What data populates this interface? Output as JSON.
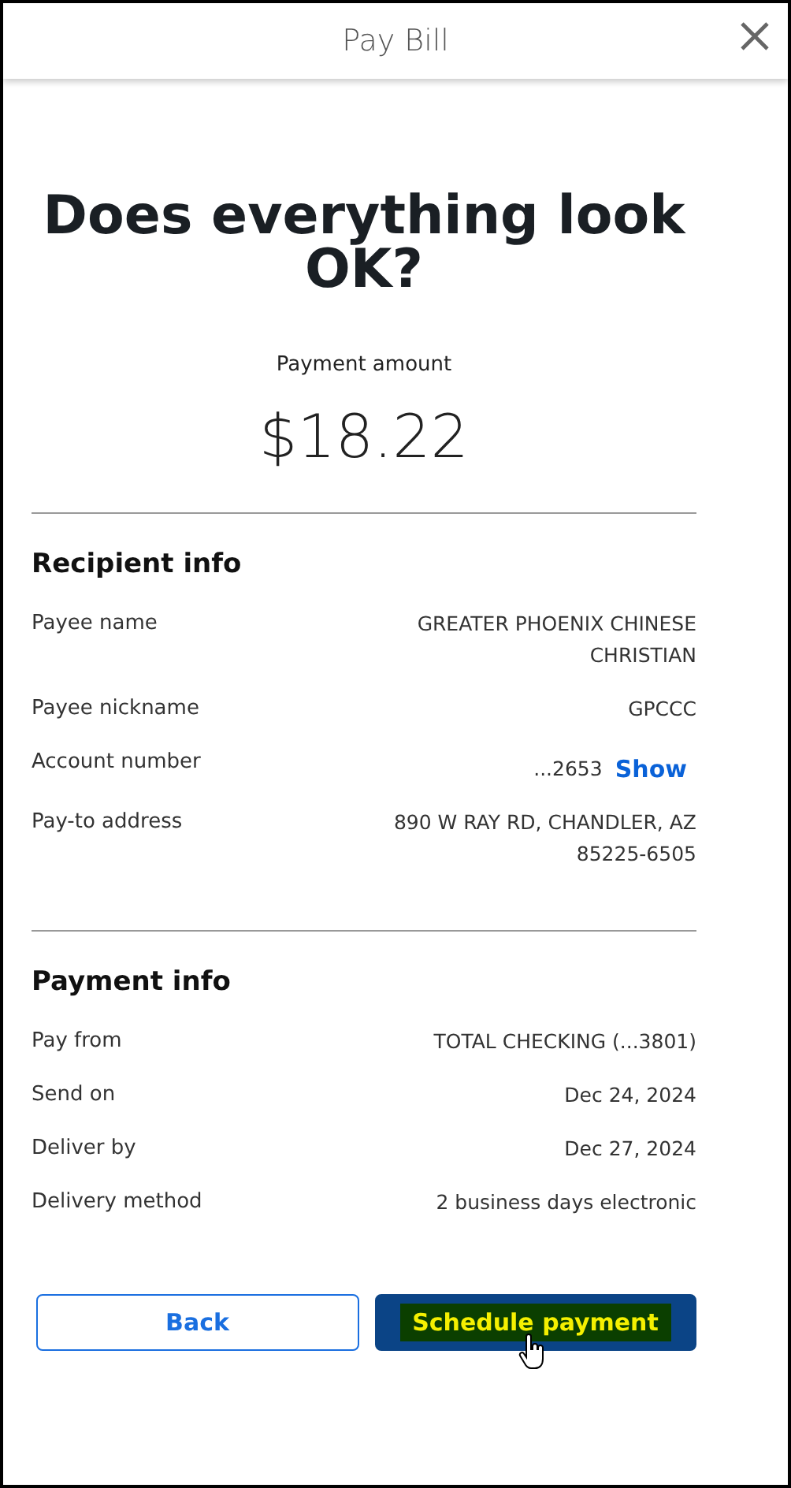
{
  "header": {
    "title": "Pay Bill"
  },
  "heading": "Does everything look OK?",
  "amount": {
    "label": "Payment amount",
    "value": "$18.22"
  },
  "sections": [
    {
      "title": "Recipient info",
      "rows": [
        {
          "kind": "text",
          "label": "Payee name",
          "value": "GREATER PHOENIX CHINESE CHRISTIAN"
        },
        {
          "kind": "text",
          "label": "Payee nickname",
          "value": "GPCCC"
        },
        {
          "kind": "masked",
          "label": "Account number",
          "value": "...2653",
          "link": "Show"
        },
        {
          "kind": "text",
          "label": "Pay-to address",
          "value": "890 W RAY RD, CHANDLER, AZ 85225-6505"
        }
      ]
    },
    {
      "title": "Payment info",
      "rows": [
        {
          "kind": "text",
          "label": "Pay from",
          "value": "TOTAL CHECKING (...3801)"
        },
        {
          "kind": "text",
          "label": "Send on",
          "value": "Dec 24, 2024"
        },
        {
          "kind": "text",
          "label": "Deliver by",
          "value": "Dec 27, 2024"
        },
        {
          "kind": "text",
          "label": "Delivery method",
          "value": "2 business days electronic"
        }
      ]
    }
  ],
  "buttons": [
    {
      "kind": "secondary",
      "label": "Back"
    },
    {
      "kind": "primary",
      "label": "Schedule payment"
    }
  ]
}
